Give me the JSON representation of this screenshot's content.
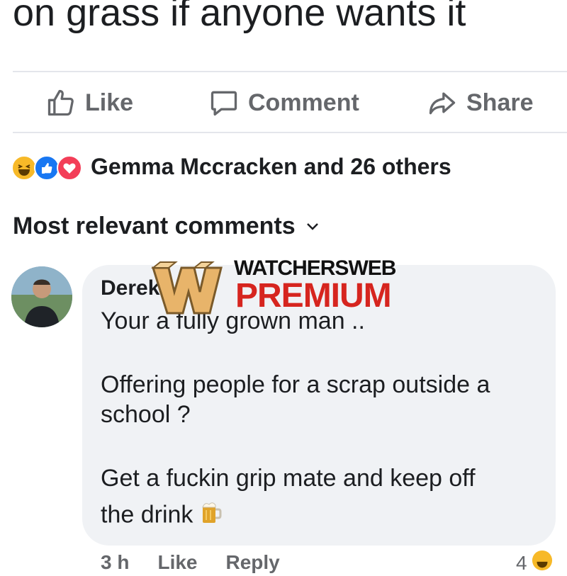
{
  "post": {
    "text": "on grass if anyone wants it"
  },
  "actions": {
    "like_label": "Like",
    "comment_label": "Comment",
    "share_label": "Share"
  },
  "reactions": {
    "icons": [
      "haha",
      "like",
      "love"
    ],
    "summary": "Gemma Mccracken and 26 others"
  },
  "comments_section": {
    "sort_label": "Most relevant comments"
  },
  "comment": {
    "author_visible": "Derek",
    "lines": [
      "Your a fully grown man ..",
      "Offering people for a scrap outside a",
      "school ?",
      "Get a fuckin grip mate and keep off",
      "the drink"
    ],
    "emoji": "beer-mug",
    "meta": {
      "time": "3 h",
      "like": "Like",
      "reply": "Reply",
      "reaction_count": "4"
    }
  },
  "watermark": {
    "top": "WATCHERSWEB",
    "bottom": "PREMIUM"
  },
  "colors": {
    "text": "#1c1e21",
    "secondary": "#65676b",
    "bubble": "#f0f2f5",
    "like_blue": "#1877f2",
    "love_red": "#f33e58",
    "haha_yellow": "#f7b928",
    "watermark_red": "#d6251f"
  }
}
